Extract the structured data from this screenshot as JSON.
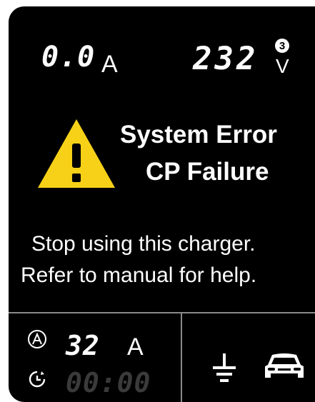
{
  "display": {
    "current_value": "0.0",
    "current_unit": "A",
    "voltage_value": "232",
    "voltage_unit": "V",
    "phase_count": "3"
  },
  "alert": {
    "title_line1": "System Error",
    "title_line2": "CP Failure",
    "message_line1": "Stop using this charger.",
    "message_line2": "Refer to manual for help.",
    "icon": "warning-triangle-icon",
    "color": "#f7d117"
  },
  "bottom": {
    "set_current_value": "32",
    "set_current_unit": "A",
    "timer": "00:00",
    "icons": [
      "ampere-icon",
      "clock-icon",
      "ground-icon",
      "car-icon"
    ]
  }
}
